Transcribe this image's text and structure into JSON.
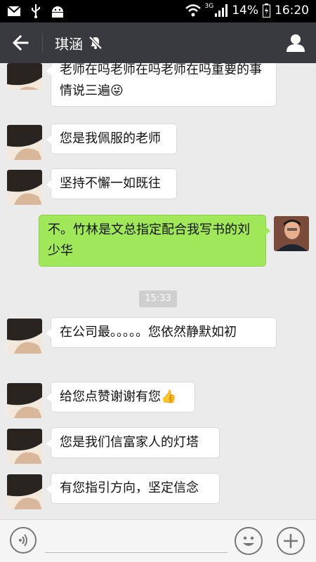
{
  "status_bar": {
    "network": "3G",
    "battery": "14%",
    "time": "16:20"
  },
  "header": {
    "title": "琪涵"
  },
  "messages": [
    {
      "text": "老师在吗老师在吗老师在吗重要的事情说三遍😜"
    },
    {
      "text": "您是我佩服的老师"
    },
    {
      "text": "坚持不懈一如既往"
    },
    {
      "text": "不。竹林是文总指定配合我写书的刘少华"
    },
    {
      "text": "在公司最。。。。。您依然静默如初"
    },
    {
      "text": "给您点赞谢谢有您👍"
    },
    {
      "text": "您是我们信富家人的灯塔"
    },
    {
      "text": "有您指引方向，坚定信念"
    }
  ],
  "timestamp": "15:33",
  "colors": {
    "header_bg": "#393a3f",
    "outgoing_bubble": "#a0e75a",
    "chat_bg": "#ebebeb"
  }
}
